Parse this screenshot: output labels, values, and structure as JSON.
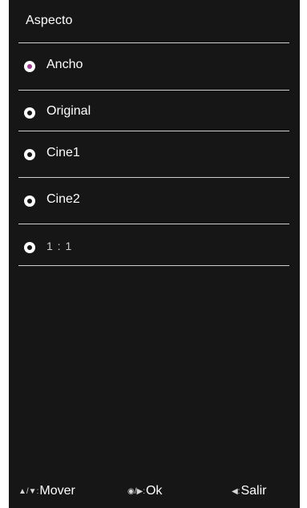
{
  "menu": {
    "title": "Aspecto",
    "options": [
      {
        "label": "Ancho",
        "selected": true
      },
      {
        "label": "Original",
        "selected": false
      },
      {
        "label": "Cine1",
        "selected": false
      },
      {
        "label": "Cine2",
        "selected": false
      },
      {
        "label": "1 : 1",
        "selected": false
      }
    ]
  },
  "footer": {
    "move": {
      "keys": "▲/▼:",
      "label": "Mover"
    },
    "ok": {
      "keys": "◉/▶:",
      "label": "Ok"
    },
    "exit": {
      "keys": "◀:",
      "label": "Salir"
    }
  },
  "colors": {
    "panel_bg": "#161616",
    "selected_dot": "#9b3f8e",
    "divider": "#cfcfcf"
  }
}
